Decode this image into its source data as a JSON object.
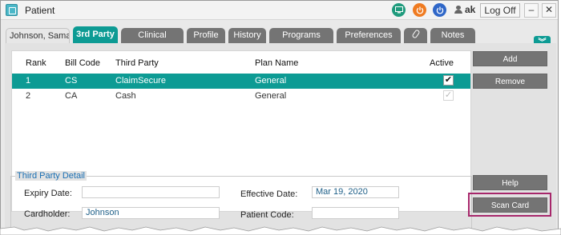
{
  "window": {
    "title": "Patient"
  },
  "toolbar": {
    "user_name": "ak",
    "logoff_label": "Log Off",
    "minimize_label": "–",
    "close_label": "✕",
    "icons": [
      "monitor-icon",
      "power-icon",
      "logout-icon",
      "user-icon"
    ]
  },
  "tabs": [
    {
      "label": "Johnson, Saman"
    },
    {
      "label": "3rd Party",
      "active": true
    },
    {
      "label": "Clinical"
    },
    {
      "label": "Profile"
    },
    {
      "label": "History"
    },
    {
      "label": "Programs"
    },
    {
      "label": "Preferences"
    },
    {
      "label": "",
      "icon": "paperclip-icon"
    },
    {
      "label": "Notes"
    }
  ],
  "collapse_glyph": "︾",
  "grid": {
    "columns": [
      "Rank",
      "Bill Code",
      "Third Party",
      "Plan Name",
      "Active"
    ],
    "rows": [
      {
        "rank": "1",
        "bill_code": "CS",
        "third_party": "ClaimSecure",
        "plan_name": "General",
        "active": "✔"
      },
      {
        "rank": "2",
        "bill_code": "CA",
        "third_party": "Cash",
        "plan_name": "General",
        "active": "✓"
      }
    ]
  },
  "buttons": {
    "add": "Add",
    "remove": "Remove",
    "help": "Help",
    "scan_card": "Scan Card"
  },
  "detail": {
    "legend": "Third Party Detail",
    "expiry_label": "Expiry Date:",
    "expiry_value": "",
    "effective_label": "Effective Date:",
    "effective_value": "Mar 19, 2020",
    "cardholder_label": "Cardholder:",
    "cardholder_value": "Johnson",
    "patient_code_label": "Patient Code:",
    "patient_code_value": ""
  },
  "colors": {
    "accent_teal": "#0d9b94",
    "tab_gray": "#747474",
    "highlight_magenta": "#a7276b"
  }
}
